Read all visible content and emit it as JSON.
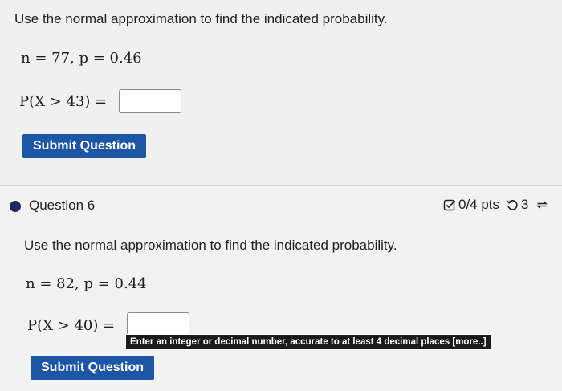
{
  "question5": {
    "prompt": "Use the normal approximation to find the indicated probability.",
    "params": "n = 77,   p = 0.46",
    "prob_expr": "P(X > 43) =",
    "answer_value": "",
    "submit_label": "Submit Question"
  },
  "question6": {
    "title": "Question 6",
    "points": "0/4 pts",
    "attempts": "3",
    "prompt": "Use the normal approximation to find the indicated probability.",
    "params": "n = 82,   p = 0.44",
    "prob_expr": "P(X > 40) =",
    "answer_value": "",
    "tooltip": "Enter an integer or decimal number, accurate to at least 4 decimal places [more..]",
    "submit_label": "Submit Question"
  },
  "icons": {
    "status": "checkbox-edit-icon",
    "retry": "retry-icon",
    "regenerate": "regenerate-icon"
  },
  "colors": {
    "button_bg": "#1c56a5",
    "dot": "#1e2a5a",
    "tooltip_bg": "#1a1a1a"
  }
}
